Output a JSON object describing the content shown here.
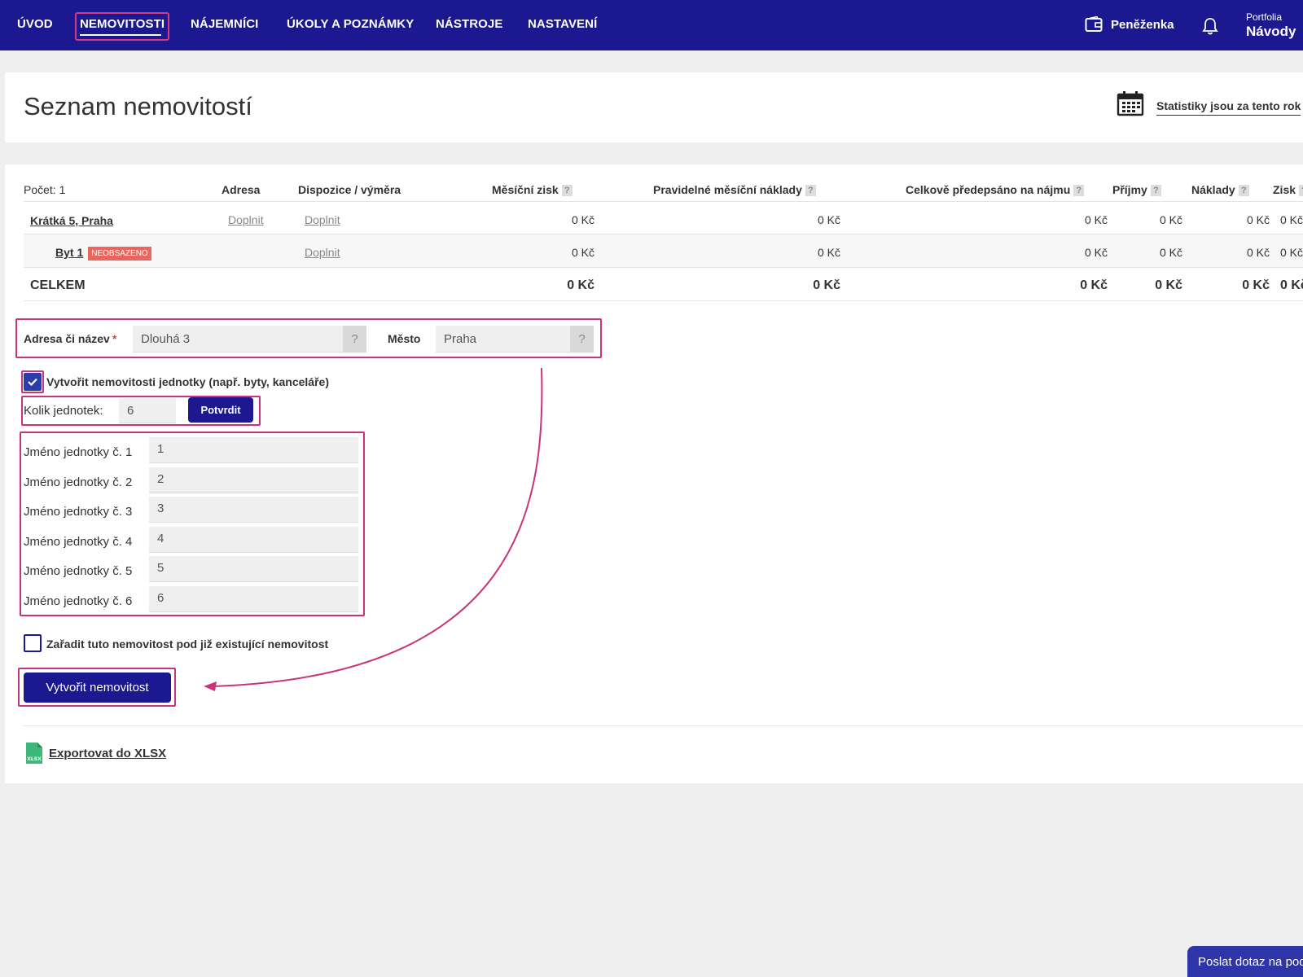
{
  "nav": {
    "items": [
      "ÚVOD",
      "NEMOVITOSTI",
      "NÁJEMNÍCI",
      "ÚKOLY A POZNÁMKY",
      "NÁSTROJE",
      "NASTAVENÍ"
    ],
    "active": "NEMOVITOSTI",
    "wallet_label": "Peněženka",
    "account_small": "Portfolia",
    "account_big": "Návody"
  },
  "header": {
    "title": "Seznam nemovitostí",
    "stats_link": "Statistiky jsou za tento rok"
  },
  "table": {
    "count_label": "Počet: 1",
    "columns": [
      "Adresa",
      "Dispozice / výměra",
      "Měsíční zisk",
      "Pravidelné měsíční náklady",
      "Celkově předepsáno na nájmu",
      "Příjmy",
      "Náklady",
      "Zisk"
    ],
    "help_glyph": "?",
    "rows": [
      {
        "name": "Krátká 5, Praha",
        "adresa": "Doplnit",
        "dispozice": "Doplnit",
        "mesicni_zisk": "0 Kč",
        "naklady": "0 Kč",
        "predepsano": "0 Kč",
        "prijmy": "0 Kč",
        "naklady2": "0 Kč",
        "zisk": "0 Kč"
      },
      {
        "name": "Byt 1",
        "badge": "NEOBSAZENO",
        "dispozice": "Doplnit",
        "mesicni_zisk": "0 Kč",
        "naklady": "0 Kč",
        "predepsano": "0 Kč",
        "prijmy": "0 Kč",
        "naklady2": "0 Kč",
        "zisk": "0 Kč"
      }
    ],
    "total": {
      "label": "CELKEM",
      "mesicni_zisk": "0 Kč",
      "naklady": "0 Kč",
      "predepsano": "0 Kč",
      "prijmy": "0 Kč",
      "naklady2": "0 Kč",
      "zisk": "0 Kč"
    }
  },
  "form": {
    "address_label": "Adresa či název",
    "required_mark": "*",
    "address_value": "Dlouhá 3",
    "city_label": "Město",
    "city_value": "Praha",
    "help_glyph": "?",
    "create_units_label": "Vytvořit nemovitosti jednotky (např. byty, kanceláře)",
    "create_units_checked": true,
    "units_count_label": "Kolik jednotek:",
    "units_count_value": "6",
    "confirm_button": "Potvrdit",
    "units": [
      {
        "label": "Jméno jednotky č. 1",
        "value": "1"
      },
      {
        "label": "Jméno jednotky č. 2",
        "value": "2"
      },
      {
        "label": "Jméno jednotky č. 3",
        "value": "3"
      },
      {
        "label": "Jméno jednotky č. 4",
        "value": "4"
      },
      {
        "label": "Jméno jednotky č. 5",
        "value": "5"
      },
      {
        "label": "Jméno jednotky č. 6",
        "value": "6"
      }
    ],
    "assign_parent_label": "Zařadit tuto nemovitost pod již existující nemovitost",
    "assign_parent_checked": false,
    "submit_button": "Vytvořit nemovitost"
  },
  "export": {
    "label": "Exportovat do XLSX",
    "icon_text": "XLSX"
  },
  "chat": {
    "label": "Poslat dotaz na podporu"
  },
  "colors": {
    "nav_bg": "#1c1890",
    "highlight": "#c9337a",
    "badge": "#e8665f",
    "export_icon": "#3cb878"
  }
}
